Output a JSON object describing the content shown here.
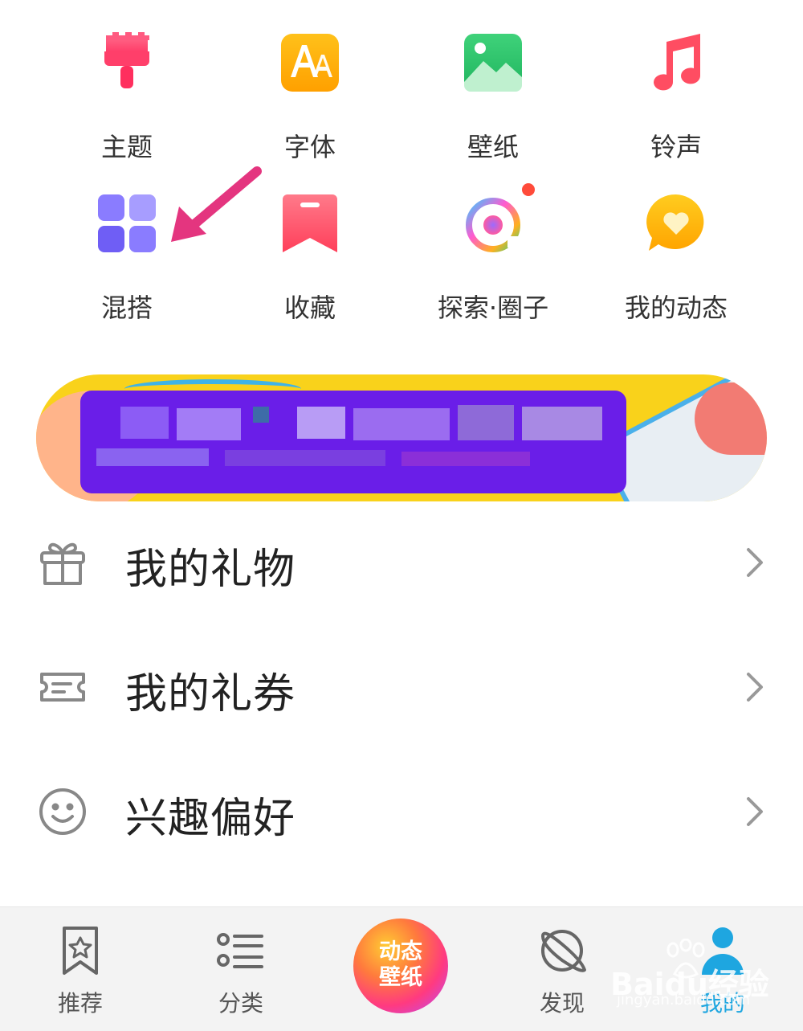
{
  "grid": {
    "items": [
      {
        "label": "主题",
        "icon": "brush-icon"
      },
      {
        "label": "字体",
        "icon": "font-icon"
      },
      {
        "label": "壁纸",
        "icon": "image-icon"
      },
      {
        "label": "铃声",
        "icon": "music-note-icon"
      },
      {
        "label": "混搭",
        "icon": "four-squares-icon"
      },
      {
        "label": "收藏",
        "icon": "bookmark-icon"
      },
      {
        "label": "探索·圈子",
        "icon": "explore-circle-icon"
      },
      {
        "label": "我的动态",
        "icon": "heart-bubble-icon"
      }
    ]
  },
  "banner": {
    "status": "pixelated"
  },
  "list": [
    {
      "label": "我的礼物",
      "icon": "gift-icon"
    },
    {
      "label": "我的礼券",
      "icon": "ticket-icon"
    },
    {
      "label": "兴趣偏好",
      "icon": "smiley-icon"
    }
  ],
  "tabbar": {
    "tabs": [
      {
        "label": "推荐",
        "icon": "bookmark-star-icon"
      },
      {
        "label": "分类",
        "icon": "list-icon"
      },
      {
        "label": "动态壁纸",
        "line1": "动态",
        "line2": "壁纸",
        "icon": "live-wallpaper-icon"
      },
      {
        "label": "发现",
        "icon": "planet-icon"
      },
      {
        "label": "我的",
        "icon": "person-icon"
      }
    ],
    "active_tab": "我的"
  },
  "watermark": {
    "main": "Baidu经验",
    "sub": "jingyan.baidu.com"
  },
  "colors": {
    "accent_active": "#1ea6e0",
    "arrow": "#e4357f",
    "banner_bg": "#f9d21b",
    "mosaic": "#6a1ee8"
  }
}
